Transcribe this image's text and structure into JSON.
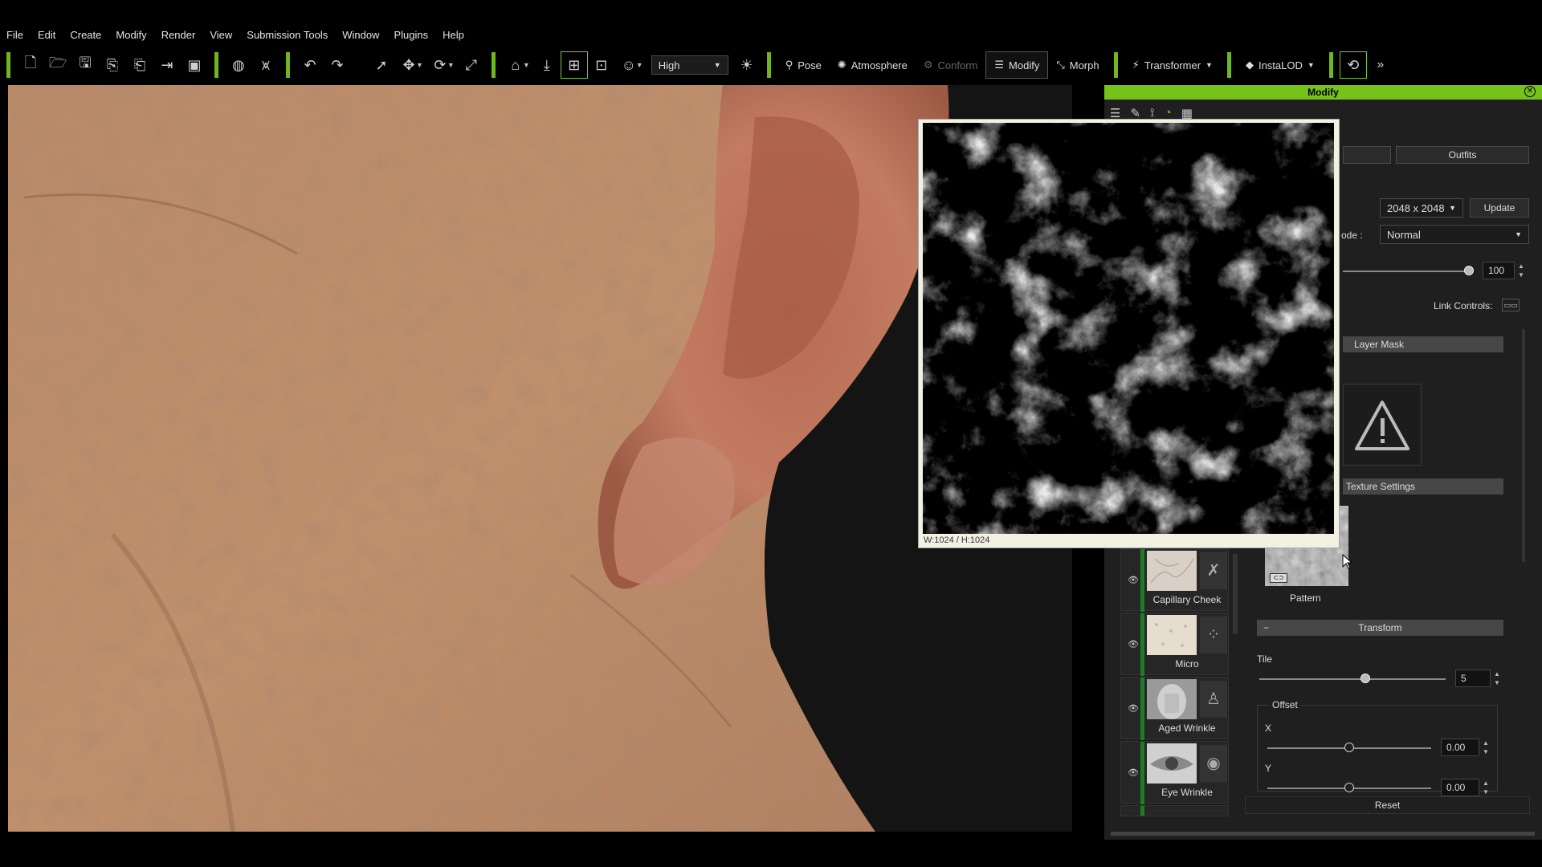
{
  "menu": [
    "File",
    "Edit",
    "Create",
    "Modify",
    "Render",
    "View",
    "Submission Tools",
    "Window",
    "Plugins",
    "Help"
  ],
  "toolbar": {
    "quality_value": "High",
    "pose_label": "Pose",
    "atmosphere_label": "Atmosphere",
    "conform_label": "Conform",
    "modify_label": "Modify",
    "morph_label": "Morph",
    "transformer_label": "Transformer",
    "instalod_label": "InstaLOD"
  },
  "panel": {
    "title": "Modify",
    "outfits_label": "Outfits",
    "resolution_value": "2048 x 2048",
    "update_label": "Update",
    "mode_label": "ode :",
    "mode_value": "Normal",
    "strength_value": "100",
    "link_controls_label": "Link Controls:",
    "layer_mask_label": "Layer Mask",
    "texture_settings_label": "Texture Settings",
    "pattern_label": "Pattern",
    "transform_label": "Transform",
    "tile_label": "Tile",
    "tile_value": "5",
    "offset_label": "Offset",
    "x_label": "X",
    "x_value": "0.00",
    "y_label": "Y",
    "y_value": "0.00",
    "reset_label": "Reset"
  },
  "layers": [
    {
      "name": "Capillary Cheek"
    },
    {
      "name": "Micro"
    },
    {
      "name": "Aged Wrinkle"
    },
    {
      "name": "Eye Wrinkle"
    }
  ],
  "preview": {
    "caption": "W:1024 / H:1024"
  },
  "colors": {
    "accent": "#75c21a",
    "layer_bar": "#1d7d24"
  }
}
